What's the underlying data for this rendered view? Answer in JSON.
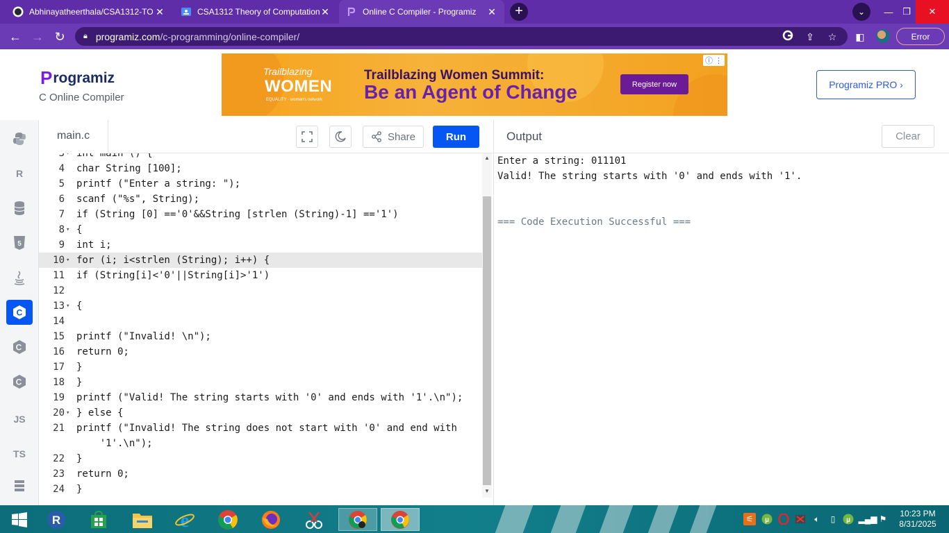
{
  "browser": {
    "tabs": [
      {
        "title": "Abhinayatheerthala/CSA1312-TO",
        "active": false
      },
      {
        "title": "CSA1312 Theory of Computation",
        "active": false
      },
      {
        "title": "Online C Compiler - Programiz",
        "active": true
      }
    ],
    "url_host": "programiz.com",
    "url_path": "/c-programming/online-compiler/",
    "error_label": "Error"
  },
  "header": {
    "logo_text": "rogramiz",
    "logo_initial": "P",
    "subtitle": "C Online Compiler",
    "pro_button": "Programiz PRO ›"
  },
  "ad": {
    "brand_line1": "Trailblazing",
    "brand_line2": "WOMEN",
    "brand_line3": "EQUALITY · women's network",
    "headline": "Trailblazing Women Summit:",
    "tagline": "Be an Agent of Change",
    "cta": "Register now"
  },
  "languages": [
    {
      "name": "python",
      "label": "",
      "active": false
    },
    {
      "name": "r",
      "label": "R",
      "active": false
    },
    {
      "name": "sql",
      "label": "",
      "active": false
    },
    {
      "name": "html",
      "label": "5",
      "active": false
    },
    {
      "name": "java",
      "label": "",
      "active": false
    },
    {
      "name": "c",
      "label": "C",
      "active": true
    },
    {
      "name": "cpp",
      "label": "C",
      "active": false
    },
    {
      "name": "csharp",
      "label": "C",
      "active": false
    },
    {
      "name": "js",
      "label": "JS",
      "active": false
    },
    {
      "name": "ts",
      "label": "TS",
      "active": false
    },
    {
      "name": "more",
      "label": "",
      "active": false
    }
  ],
  "editor": {
    "filename": "main.c",
    "share_label": "Share",
    "run_label": "Run",
    "lines": [
      {
        "n": "3",
        "code": "int main () {",
        "fold": true
      },
      {
        "n": "4",
        "code": "char String [100];",
        "fold": false
      },
      {
        "n": "5",
        "code": "printf (\"Enter a string: \");",
        "fold": false
      },
      {
        "n": "6",
        "code": "scanf (\"%s\", String);",
        "fold": false
      },
      {
        "n": "7",
        "code": "if (String [0] =='0'&&String [strlen (String)-1] =='1')",
        "fold": false
      },
      {
        "n": "8",
        "code": "{",
        "fold": true
      },
      {
        "n": "9",
        "code": "int i;",
        "fold": false
      },
      {
        "n": "10",
        "code": "for (i; i<strlen (String); i++) {",
        "fold": true
      },
      {
        "n": "11",
        "code": "if (String[i]<'0'||String[i]>'1')",
        "fold": false
      },
      {
        "n": "12",
        "code": "",
        "fold": false
      },
      {
        "n": "13",
        "code": "{",
        "fold": true
      },
      {
        "n": "14",
        "code": "",
        "fold": false
      },
      {
        "n": "15",
        "code": "printf (\"Invalid! \\n\");",
        "fold": false
      },
      {
        "n": "16",
        "code": "return 0;",
        "fold": false
      },
      {
        "n": "17",
        "code": "}",
        "fold": false
      },
      {
        "n": "18",
        "code": "}",
        "fold": false
      },
      {
        "n": "19",
        "code": "printf (\"Valid! The string starts with '0' and ends with '1'.\\n\");",
        "fold": false
      },
      {
        "n": "20",
        "code": "} else {",
        "fold": true
      },
      {
        "n": "21",
        "code": "printf (\"Invalid! The string does not start with '0' and end with",
        "fold": false
      },
      {
        "n": "",
        "code": "    '1'.\\n\");",
        "fold": false
      },
      {
        "n": "22",
        "code": "}",
        "fold": false
      },
      {
        "n": "23",
        "code": "return 0;",
        "fold": false
      },
      {
        "n": "24",
        "code": "}",
        "fold": false
      }
    ],
    "highlighted_line": "10"
  },
  "output": {
    "title": "Output",
    "clear_label": "Clear",
    "lines": [
      {
        "text": "Enter a string: 011101",
        "type": "normal"
      },
      {
        "text": "Valid! The string starts with '0' and ends with '1'.",
        "type": "normal"
      },
      {
        "text": "",
        "type": "normal"
      },
      {
        "text": "",
        "type": "normal"
      },
      {
        "text": "=== Code Execution Successful ===",
        "type": "success"
      }
    ]
  },
  "taskbar": {
    "time": "10:23 PM",
    "date": "8/31/2025"
  },
  "colors": {
    "browser_purple": "#6b3bb6",
    "run_blue": "#0556f3",
    "logo_purple": "#7a1ee0",
    "taskbar_teal": "#117f8a"
  }
}
